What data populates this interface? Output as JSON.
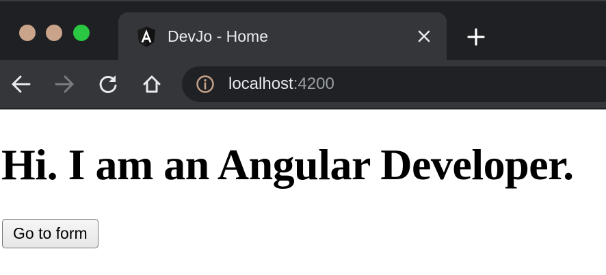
{
  "window": {
    "traffic_colors": {
      "close": "#c9a48a",
      "minimize": "#c9a48a",
      "zoom": "#2ac842"
    }
  },
  "tab": {
    "title": "DevJo - Home",
    "favicon": "angular-logo-icon",
    "close_icon": "close-icon"
  },
  "new_tab_icon": "plus-icon",
  "toolbar": {
    "back_icon": "arrow-left-icon",
    "forward_icon": "arrow-right-icon",
    "reload_icon": "reload-icon",
    "home_icon": "home-icon",
    "site_info_icon": "info-icon",
    "url_host": "localhost",
    "url_port": ":4200"
  },
  "page": {
    "heading": "Hi. I am an Angular Developer.",
    "button_label": "Go to form"
  },
  "colors": {
    "tabstrip": "#1f2023",
    "active_tab": "#35363a",
    "omnibox": "#202124",
    "page_background": "#ffffff"
  }
}
